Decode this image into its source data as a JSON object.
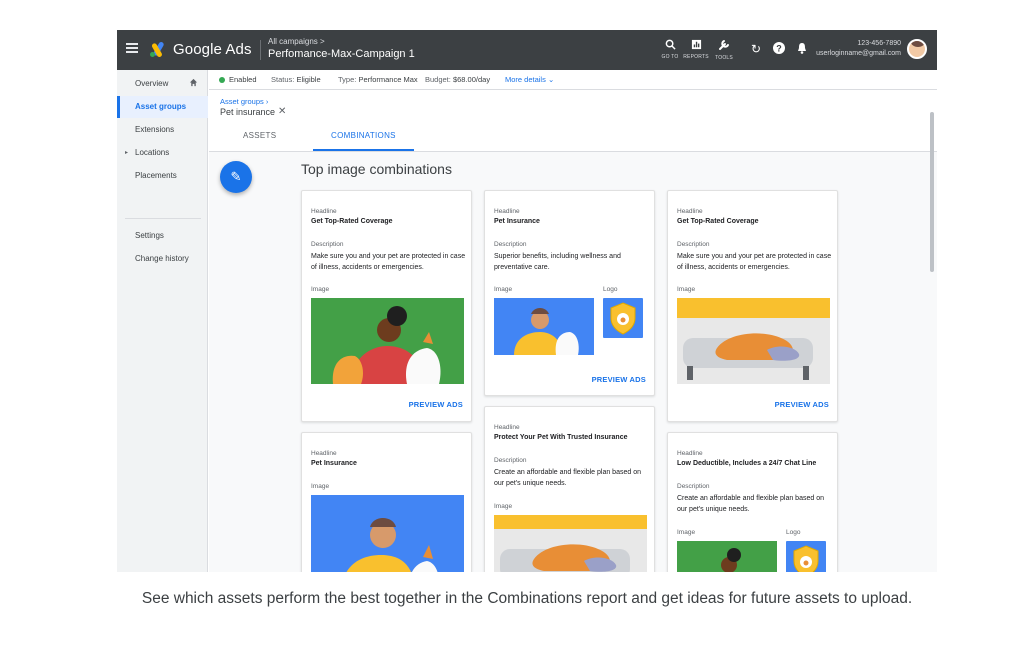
{
  "topbar": {
    "brand": "Google Ads",
    "breadcrumb": "All campaigns >",
    "campaign_name": "Perfomance-Max-Campaign 1",
    "tools": [
      {
        "icon": "search-icon",
        "label": "GO TO"
      },
      {
        "icon": "reports-icon",
        "label": "REPORTS"
      },
      {
        "icon": "wrench-icon",
        "label": "TOOLS"
      }
    ],
    "account_phone": "123-456-7890",
    "account_email": "userloginname@gmail.com"
  },
  "sidebar": {
    "items": [
      {
        "label": "Overview",
        "icon": "home-icon"
      },
      {
        "label": "Asset groups",
        "active": true
      },
      {
        "label": "Extensions"
      },
      {
        "label": "Locations",
        "expandable": true
      },
      {
        "label": "Placements"
      },
      {
        "label": "Settings"
      },
      {
        "label": "Change history"
      }
    ]
  },
  "status_bar": {
    "state": "Enabled",
    "status_label": "Status:",
    "status_value": "Eligible",
    "type_label": "Type:",
    "type_value": "Performance Max",
    "budget_label": "Budget:",
    "budget_value": "$68.00/day",
    "more_details": "More details"
  },
  "breadcrumb": {
    "parent": "Asset groups",
    "current": "Pet insurance"
  },
  "tabs": [
    {
      "label": "ASSETS"
    },
    {
      "label": "COMBINATIONS",
      "active": true
    }
  ],
  "section_title": "Top image combinations",
  "labels": {
    "headline": "Headline",
    "description": "Description",
    "image": "Image",
    "logo": "Logo",
    "preview": "PREVIEW ADS"
  },
  "cards": [
    {
      "headline": "Get Top-Rated Coverage",
      "description": "Make sure you and your pet are protected in case of illness, accidents or emergencies."
    },
    {
      "headline": "Pet Insurance",
      "description": "Superior benefits, including wellness and preventative care."
    },
    {
      "headline": "Get Top-Rated Coverage",
      "description": "Make sure you and your pet are protected in case of illness, accidents or emergencies."
    },
    {
      "headline": "Pet Insurance"
    },
    {
      "headline": "Protect Your Pet With Trusted Insurance",
      "description": "Create an affordable and flexible plan based on our pet's unique needs."
    },
    {
      "headline": "Low Deductible, Includes a 24/7 Chat Line",
      "description": "Create an affordable and flexible plan based on our pet's unique needs."
    }
  ],
  "caption": "See which assets perform the best together in the Combinations report and get ideas for future assets to upload.",
  "colors": {
    "topbar": "#3c4043",
    "accent": "#1a73e8",
    "enabled": "#34a853",
    "image_green": "#43a047",
    "image_blue": "#4285f4",
    "image_yellow": "#f9c02e"
  }
}
